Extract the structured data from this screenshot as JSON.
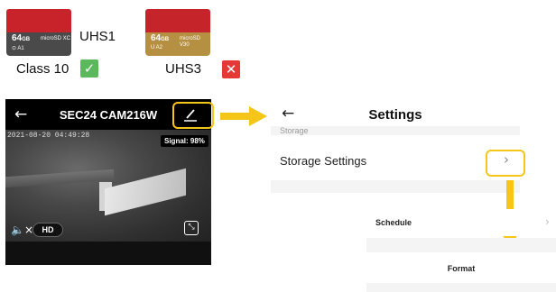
{
  "cards": {
    "card1": {
      "capacity": "64",
      "unit": "GB",
      "sub": "⊙ A1",
      "brand": "microSD XC"
    },
    "card2": {
      "capacity": "64",
      "unit": "GB",
      "sub": "U A2",
      "brand": "microSD V30"
    }
  },
  "captions": {
    "uhs1": "UHS1",
    "class10": "Class 10",
    "uhs3": "UHS3"
  },
  "badges": {
    "ok": "✓",
    "bad": "✕",
    "ok_color": "#5cb85c",
    "bad_color": "#e53935"
  },
  "camera": {
    "back_icon": "arrow-left-icon",
    "title": "SEC24 CAM216W",
    "timestamp": "2021-08-20 04:49:28",
    "signal": "Signal: 98%",
    "quality": "HD",
    "mute_icon": "🔈×",
    "expand_icon": "⤡"
  },
  "settings": {
    "title": "Settings",
    "faded_section": "Storage",
    "row_label": "Storage Settings",
    "chevron": "›"
  },
  "storage_options": {
    "schedule": "Schedule",
    "schedule_chevron": "›",
    "format": "Format"
  },
  "colors": {
    "highlight": "#f5c518"
  }
}
